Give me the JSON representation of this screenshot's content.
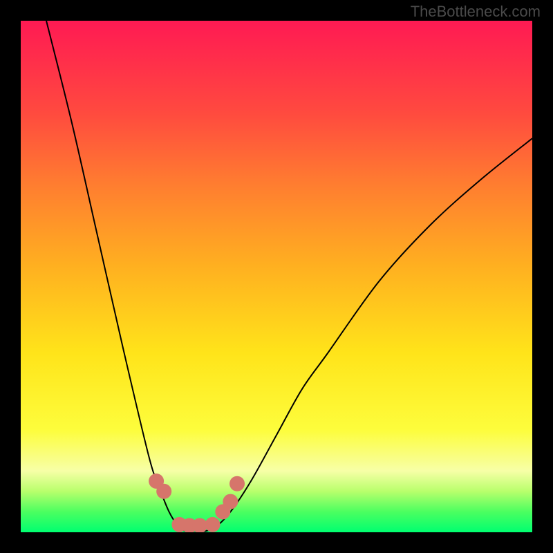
{
  "watermark": {
    "text": "TheBottleneck.com"
  },
  "chart_data": {
    "type": "line",
    "title": "",
    "xlabel": "",
    "ylabel": "",
    "xlim": [
      0,
      100
    ],
    "ylim": [
      0,
      100
    ],
    "grid": false,
    "series": [
      {
        "name": "bottleneck-curve",
        "x": [
          5,
          10,
          15,
          20,
          25,
          27,
          29,
          31,
          33,
          35,
          38,
          41,
          45,
          50,
          55,
          60,
          70,
          80,
          90,
          100
        ],
        "y": [
          100,
          80,
          58,
          36,
          15,
          9,
          4,
          1,
          0,
          0,
          1,
          4,
          10,
          19,
          28,
          35,
          49,
          60,
          69,
          77
        ]
      }
    ],
    "markers": {
      "name": "highlight-points",
      "x": [
        26.5,
        28.0,
        31.0,
        33.0,
        35.0,
        37.5,
        39.5,
        41.0,
        42.3
      ],
      "y": [
        10.0,
        8.0,
        1.5,
        1.3,
        1.3,
        1.5,
        4.0,
        6.0,
        9.5
      ]
    },
    "colors": {
      "curve": "#000000",
      "marker": "#d6756b",
      "gradient_top": "#ff1a53",
      "gradient_bottom": "#00ff70",
      "frame": "#000000"
    }
  }
}
